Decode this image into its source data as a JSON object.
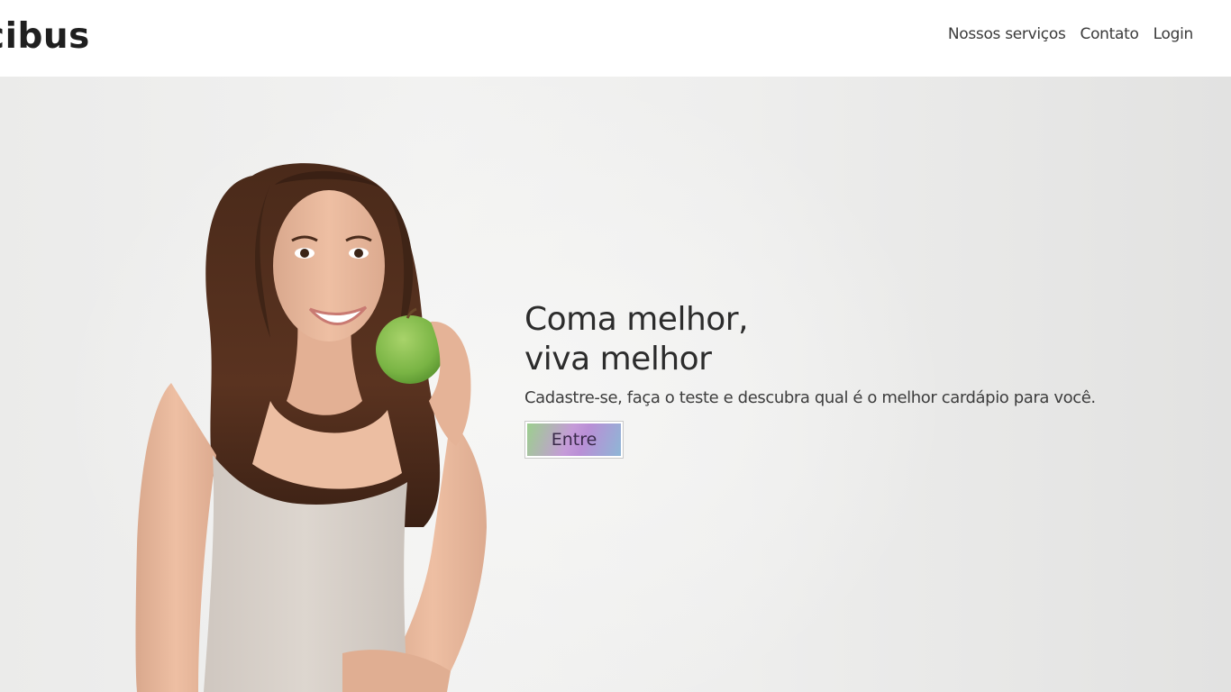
{
  "header": {
    "logo": "cibus",
    "nav": [
      "Nossos serviços",
      "Contato",
      "Login"
    ]
  },
  "hero": {
    "headline_line1": "Coma melhor,",
    "headline_line2": "viva melhor",
    "subtitle": "Cadastre-se, faça o teste e descubra qual é o melhor cardápio para você.",
    "cta_label": "Entre"
  },
  "colors": {
    "background": "#ffffff",
    "hero_background": "#efefee",
    "text": "#2c2c2c",
    "apple": "#7cb84a",
    "cta_gradient": [
      "#9ccf8e",
      "#c59bd8",
      "#8eb6d6"
    ]
  },
  "images": {
    "hero_photo": "woman-holding-green-apple"
  }
}
